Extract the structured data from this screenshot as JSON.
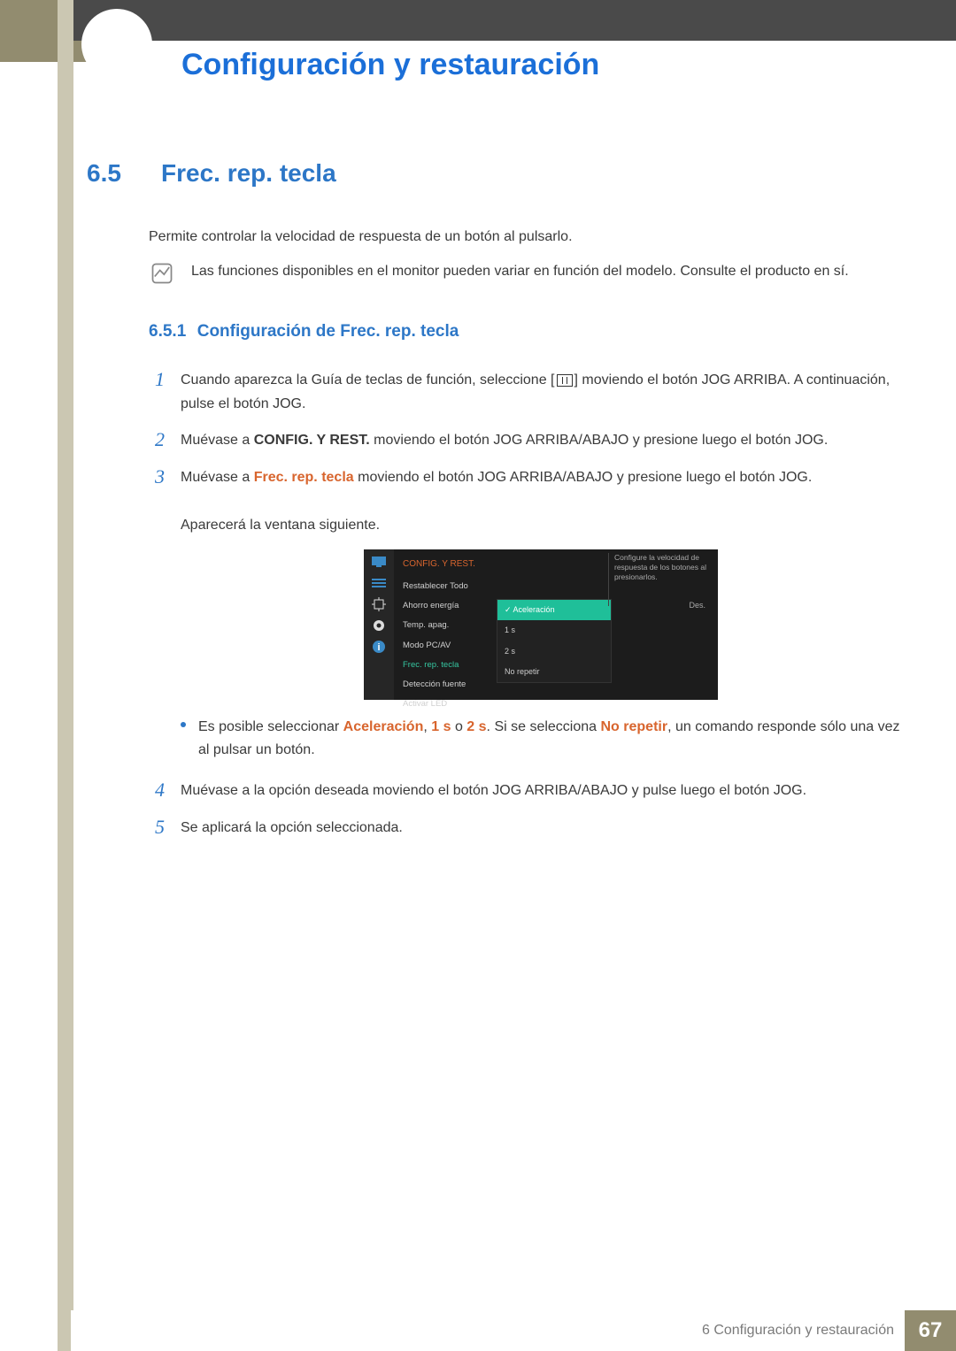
{
  "chapter_title": "Configuración y restauración",
  "section": {
    "num": "6.5",
    "title": "Frec. rep. tecla",
    "intro": "Permite controlar la velocidad de respuesta de un botón al pulsarlo.",
    "note": "Las funciones disponibles en el monitor pueden variar en función del modelo. Consulte el producto en sí."
  },
  "subsection": {
    "num": "6.5.1",
    "title": "Configuración de Frec. rep. tecla"
  },
  "steps": {
    "s1a": "Cuando aparezca la Guía de teclas de función, seleccione [",
    "s1b": "] moviendo el botón JOG ARRIBA. A continuación, pulse el botón JOG.",
    "s2a": "Muévase a ",
    "s2_bold": "CONFIG. Y REST.",
    "s2b": " moviendo el botón JOG ARRIBA/ABAJO y presione luego el botón JOG.",
    "s3a": "Muévase a ",
    "s3_orange": "Frec. rep. tecla",
    "s3b": " moviendo el botón JOG ARRIBA/ABAJO y presione luego el botón JOG.",
    "s3c": "Aparecerá la ventana siguiente.",
    "bullet_a": "Es posible seleccionar ",
    "bullet_acc": "Aceleración",
    "bullet_comma1": ", ",
    "bullet_1s": "1 s",
    "bullet_o": " o ",
    "bullet_2s": "2 s",
    "bullet_mid": ". Si se selecciona ",
    "bullet_norep": "No repetir",
    "bullet_end": ", un comando responde sólo una vez al pulsar un botón.",
    "s4": "Muévase a la opción deseada moviendo el botón JOG ARRIBA/ABAJO y pulse luego el botón JOG.",
    "s5": "Se aplicará la opción seleccionada."
  },
  "osd": {
    "title": "CONFIG. Y REST.",
    "items": [
      "Restablecer Todo",
      "Ahorro energía",
      "Temp. apag.",
      "Modo PC/AV",
      "Frec. rep. tecla",
      "Detección fuente",
      "Activar LED"
    ],
    "val_off": "Des.",
    "popup": [
      "Aceleración",
      "1 s",
      "2 s",
      "No repetir"
    ],
    "help": "Configure la velocidad de respuesta de los botones al presionarlos."
  },
  "footer": {
    "text": "6 Configuración y restauración",
    "page": "67"
  }
}
